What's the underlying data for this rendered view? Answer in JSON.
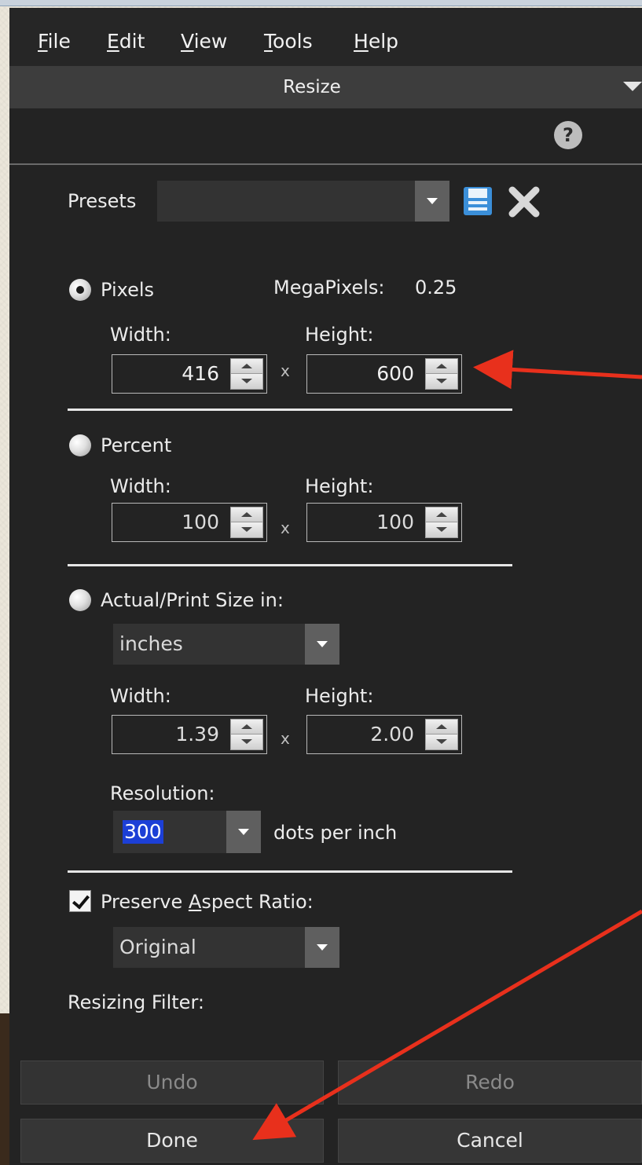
{
  "menu": {
    "file": "File",
    "file_key": "F",
    "edit": "Edit",
    "edit_key": "E",
    "view": "View",
    "view_key": "V",
    "tools": "Tools",
    "tools_key": "T",
    "help": "Help",
    "help_key": "H"
  },
  "panel": {
    "title": "Resize",
    "help_glyph": "?"
  },
  "presets": {
    "label": "Presets",
    "value": ""
  },
  "pixels": {
    "label": "Pixels",
    "selected": true,
    "megapixels_label": "MegaPixels:",
    "megapixels_value": "0.25",
    "width_label": "Width:",
    "height_label": "Height:",
    "width": "416",
    "height": "600",
    "times": "x"
  },
  "percent": {
    "label": "Percent",
    "width_label": "Width:",
    "height_label": "Height:",
    "width": "100",
    "height": "100",
    "times": "x"
  },
  "print_size": {
    "label": "Actual/Print Size in:",
    "unit": "inches",
    "width_label": "Width:",
    "height_label": "Height:",
    "width": "1.39",
    "height": "2.00",
    "times": "x",
    "resolution_label": "Resolution:",
    "resolution": "300",
    "resolution_unit": "dots per inch"
  },
  "aspect": {
    "label_pre": "Preserve ",
    "label_key": "A",
    "label_post": "spect Ratio:",
    "checked": true,
    "value": "Original"
  },
  "filter": {
    "label": "Resizing Filter:"
  },
  "buttons": {
    "undo": "Undo",
    "redo": "Redo",
    "done": "Done",
    "cancel": "Cancel"
  },
  "colors": {
    "panel_bg": "#232323",
    "title_bg": "#3d3d3d",
    "annotation_arrow": "#e8301c",
    "selection_highlight": "#1c3fd6"
  }
}
